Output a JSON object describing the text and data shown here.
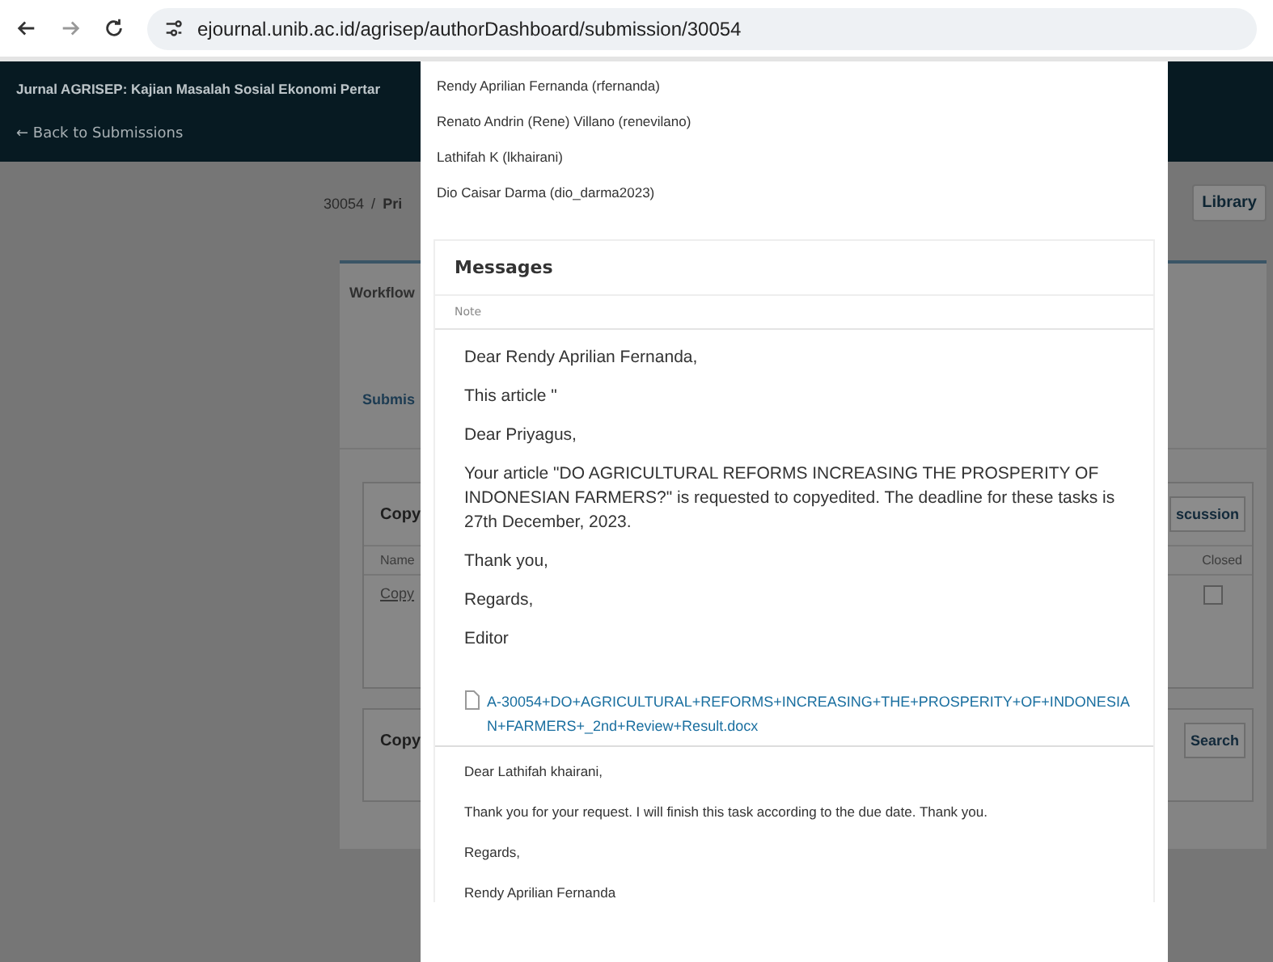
{
  "browser": {
    "url": "ejournal.unib.ac.id/agrisep/authorDashboard/submission/30054"
  },
  "header": {
    "title": "Jurnal AGRISEP: Kajian Masalah Sosial Ekonomi Pertar",
    "back_link": "← Back to Submissions"
  },
  "breadcrumb": {
    "id": "30054",
    "separator": "/",
    "title": "Pri"
  },
  "library_button": "Library",
  "tabs": [
    {
      "label": "Workflow",
      "selected": true
    }
  ],
  "subtabs": [
    {
      "label": "Submis",
      "selected": true
    }
  ],
  "copyediting_card": {
    "title": "Copy",
    "button": "scussion",
    "columns": [
      "Name",
      "Closed"
    ],
    "rows": [
      {
        "name": "Copy",
        "closed": false
      }
    ]
  },
  "files_card": {
    "title": "Copy",
    "button": "Search"
  },
  "participants": [
    "Rendy Aprilian Fernanda (rfernanda)",
    "Renato Andrin (Rene) Villano (renevilano)",
    "Lathifah K (lkhairani)",
    "Dio Caisar Darma (dio_darma2023)"
  ],
  "messages": {
    "title": "Messages",
    "column": "Note",
    "items": [
      {
        "paragraphs": [
          "Dear Rendy Aprilian Fernanda,",
          "This article \"",
          "Dear Priyagus,",
          "Your article \"DO AGRICULTURAL REFORMS INCREASING THE PROSPERITY OF INDONESIAN FARMERS?\" is requested to copyedited. The deadline for these tasks is 27th December, 2023.",
          "Thank you,",
          "Regards,",
          "Editor"
        ],
        "attachment": "A-30054+DO+AGRICULTURAL+REFORMS+INCREASING+THE+PROSPERITY+OF+INDONESIAN+FARMERS+_2nd+Review+Result.docx"
      },
      {
        "paragraphs": [
          "Dear Lathifah khairani,",
          "Thank you for your request. I will finish this task according to the due date. Thank you.",
          "Regards,",
          "Rendy Aprilian Fernanda"
        ]
      }
    ]
  }
}
